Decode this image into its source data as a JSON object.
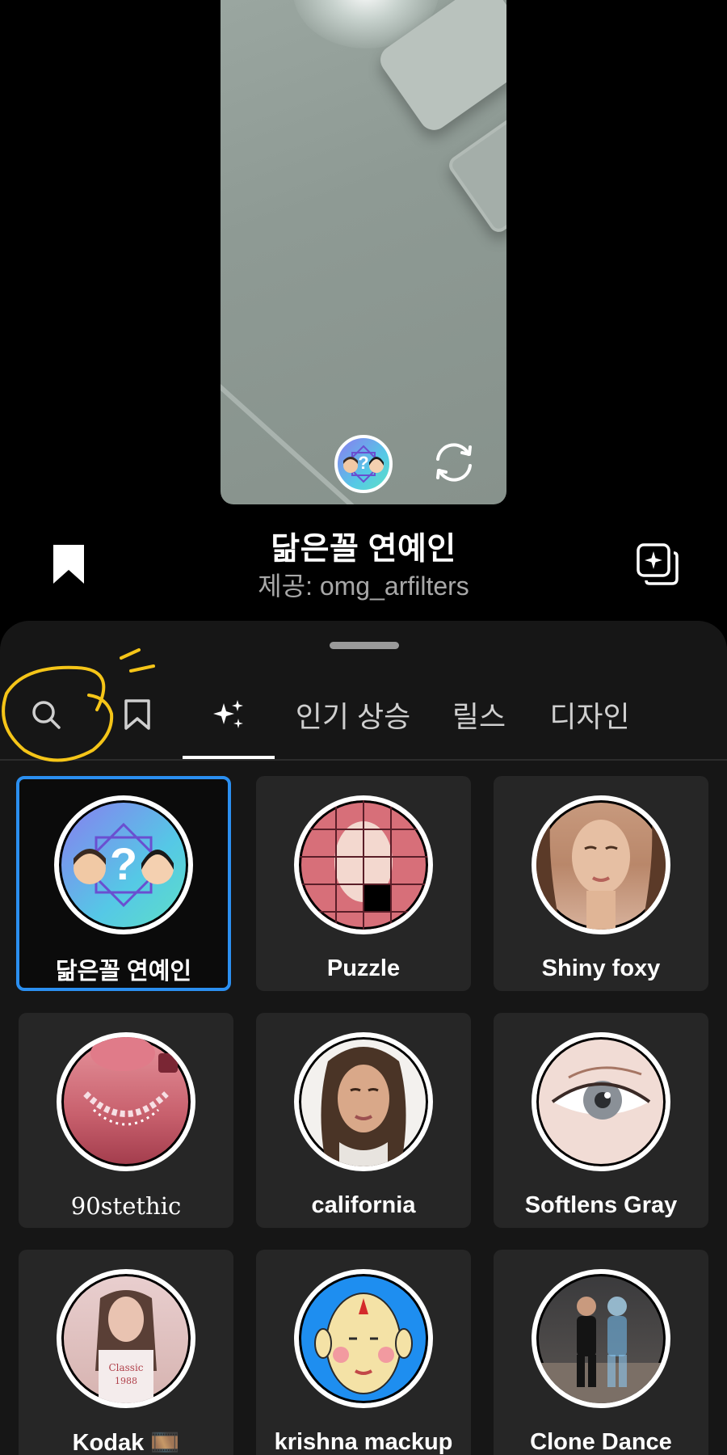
{
  "preview": {
    "selected_effect_icon": "face-match-question-icon",
    "flip_icon": "camera-flip-icon"
  },
  "effect": {
    "title": "닮은꼴 연예인",
    "credit": "제공: omg_arfilters"
  },
  "tabs": [
    {
      "label": "",
      "icon": "search-icon"
    },
    {
      "label": "",
      "icon": "bookmark-outline-icon"
    },
    {
      "label": "",
      "icon": "sparkles-icon",
      "active": true
    },
    {
      "label": "인기 상승"
    },
    {
      "label": "릴스"
    },
    {
      "label": "디자인"
    }
  ],
  "effects": [
    {
      "name": "닮은꼴 연예인",
      "selected": true
    },
    {
      "name": "Puzzle"
    },
    {
      "name": "Shiny foxy"
    },
    {
      "name": "90stethic"
    },
    {
      "name": "california"
    },
    {
      "name": "Softlens Gray"
    },
    {
      "name": "Kodak 🎞️"
    },
    {
      "name": "krishna mackup"
    },
    {
      "name": "Clone Dance"
    }
  ],
  "colors": {
    "accent_selected": "#2b8ff0",
    "annotation": "#f5c518",
    "sheet_bg": "#161616",
    "cell_bg": "#262626"
  }
}
